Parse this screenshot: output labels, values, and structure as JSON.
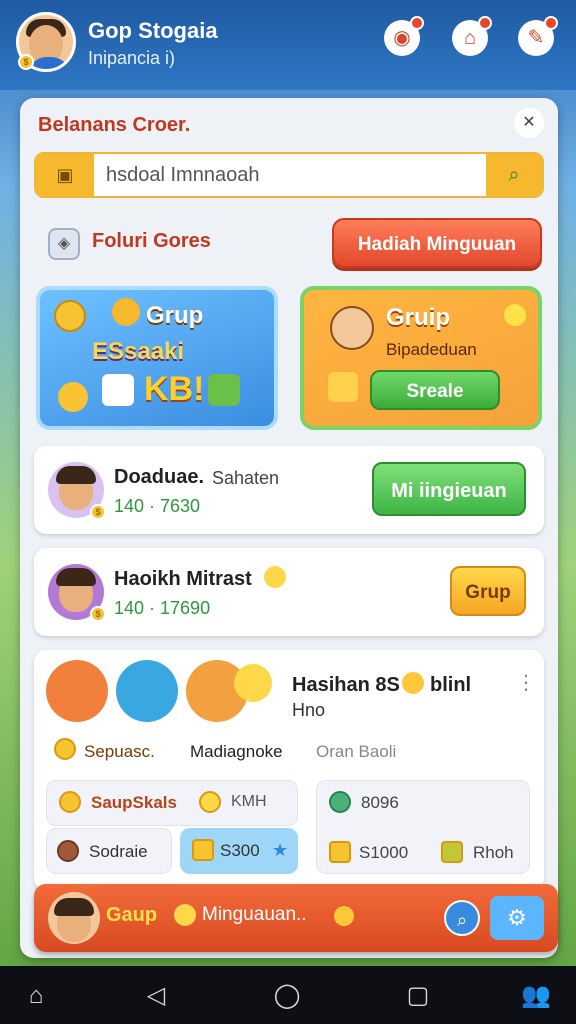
{
  "header": {
    "user_name": "Gop Stogaia",
    "user_sub": "Inipancia i)",
    "icons": [
      "game-controller-icon",
      "house-icon",
      "tools-icon"
    ]
  },
  "panel": {
    "title": "Belanans Croer.",
    "close_icon": "✕"
  },
  "search": {
    "left_icon": "lock-icon",
    "value": "hsdoal Imnnaoah",
    "button_icon": "search-icon"
  },
  "section": {
    "title": "Foluri Gores",
    "hadiah_button": "Hadiah Minguuan"
  },
  "tiles": {
    "blue": {
      "title": "Grup",
      "sub": "ESsaaki",
      "sub2": "KB!"
    },
    "orange": {
      "title": "Gruip",
      "sub": "Bipadeduan",
      "button": "Sreale"
    }
  },
  "cards": [
    {
      "name": "Doaduae.",
      "extra": "Sahaten",
      "number": "140 · 7630",
      "button": "Mi  iingieuan"
    },
    {
      "name": "Haoikh Mitrast",
      "number": "140 · 17690",
      "button": "Grup"
    }
  ],
  "group_card": {
    "title": "Hasihan 8S",
    "title2": "blinl",
    "sub": "Hno",
    "labels": [
      "Sepuasc.",
      "Madiagnoke",
      "Oran Baoli"
    ],
    "box_left": {
      "title": "SaupSkals",
      "value": "KMH",
      "item1": "Sodraie",
      "item2": "S300"
    },
    "box_right": {
      "value1": "8096",
      "value2": "S1000",
      "value3": "Rhoh"
    }
  },
  "bottom": {
    "label1": "Gaup",
    "label2": "Minguauan..",
    "search_icon": "search-icon",
    "gear_icon": "gear-icon"
  },
  "android_nav": [
    "home-icon",
    "back-icon",
    "home-circle-icon",
    "recents-icon",
    "people-icon"
  ]
}
